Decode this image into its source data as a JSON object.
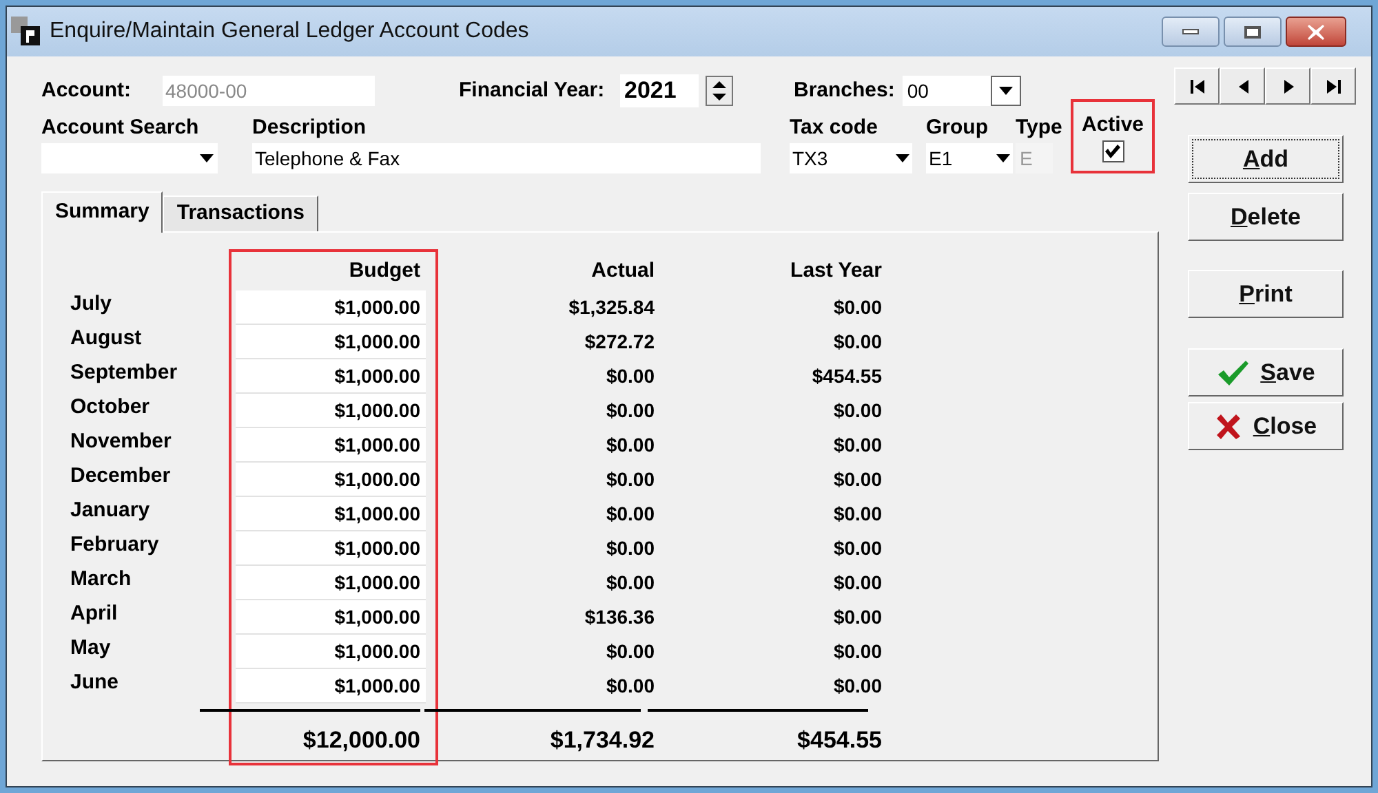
{
  "window": {
    "title": "Enquire/Maintain General Ledger Account Codes"
  },
  "account": {
    "label": "Account:",
    "value": "48000-00",
    "disabled": true
  },
  "financial_year": {
    "label": "Financial Year:",
    "value": "2021"
  },
  "branches": {
    "label": "Branches:",
    "value": "00"
  },
  "account_search": {
    "label": "Account Search"
  },
  "description": {
    "label": "Description",
    "value": "Telephone & Fax"
  },
  "tax_code": {
    "label": "Tax code",
    "value": "TX3"
  },
  "group": {
    "label": "Group",
    "value": "E1"
  },
  "type": {
    "label": "Type",
    "value": "E",
    "disabled": true
  },
  "active": {
    "label": "Active",
    "checked": true,
    "highlighted": true
  },
  "tabs": [
    {
      "label": "Summary",
      "selected": true
    },
    {
      "label": "Transactions",
      "selected": false
    }
  ],
  "table": {
    "columns": [
      "Budget",
      "Actual",
      "Last Year"
    ],
    "budget_highlighted": true,
    "rows": [
      {
        "month": "July",
        "budget": "$1,000.00",
        "actual": "$1,325.84",
        "last_year": "$0.00"
      },
      {
        "month": "August",
        "budget": "$1,000.00",
        "actual": "$272.72",
        "last_year": "$0.00"
      },
      {
        "month": "September",
        "budget": "$1,000.00",
        "actual": "$0.00",
        "last_year": "$454.55"
      },
      {
        "month": "October",
        "budget": "$1,000.00",
        "actual": "$0.00",
        "last_year": "$0.00"
      },
      {
        "month": "November",
        "budget": "$1,000.00",
        "actual": "$0.00",
        "last_year": "$0.00"
      },
      {
        "month": "December",
        "budget": "$1,000.00",
        "actual": "$0.00",
        "last_year": "$0.00"
      },
      {
        "month": "January",
        "budget": "$1,000.00",
        "actual": "$0.00",
        "last_year": "$0.00"
      },
      {
        "month": "February",
        "budget": "$1,000.00",
        "actual": "$0.00",
        "last_year": "$0.00"
      },
      {
        "month": "March",
        "budget": "$1,000.00",
        "actual": "$0.00",
        "last_year": "$0.00"
      },
      {
        "month": "April",
        "budget": "$1,000.00",
        "actual": "$136.36",
        "last_year": "$0.00"
      },
      {
        "month": "May",
        "budget": "$1,000.00",
        "actual": "$0.00",
        "last_year": "$0.00"
      },
      {
        "month": "June",
        "budget": "$1,000.00",
        "actual": "$0.00",
        "last_year": "$0.00"
      }
    ],
    "totals": {
      "budget": "$12,000.00",
      "actual": "$1,734.92",
      "last_year": "$454.55"
    }
  },
  "buttons": [
    {
      "label": "Add",
      "kind": "plain",
      "focused": true
    },
    {
      "label": "Delete",
      "kind": "plain",
      "focused": false
    },
    {
      "label": "Print",
      "kind": "plain",
      "focused": false
    },
    {
      "label": "Save",
      "kind": "save",
      "focused": false
    },
    {
      "label": "Close",
      "kind": "close",
      "focused": false
    }
  ]
}
